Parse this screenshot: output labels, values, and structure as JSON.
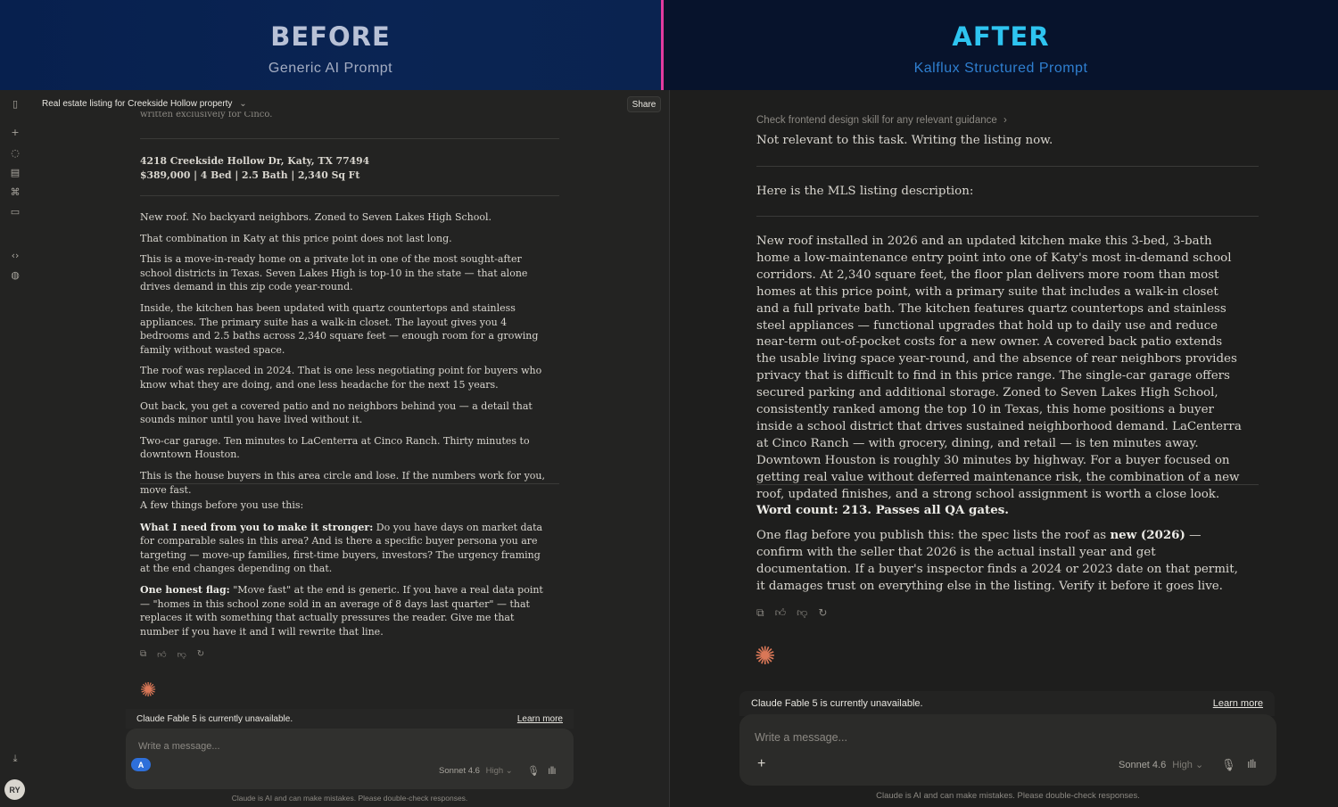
{
  "banners": {
    "before": {
      "title": "BEFORE",
      "subtitle": "Generic AI Prompt"
    },
    "after": {
      "title": "AFTER",
      "subtitle": "Kalflux Structured Prompt"
    }
  },
  "colors": {
    "divider": "#e13ba0",
    "after_title": "#2ec4f0",
    "after_subtitle": "#2f7fd0",
    "claude_star": "#d97757"
  },
  "left": {
    "conversation_title": "Real estate listing for Creekside Hollow property",
    "share_label": "Share",
    "avatar_initials": "RY",
    "rail_icons": [
      "sidebar-toggle-icon",
      "plus-icon",
      "chat-icon",
      "projects-icon",
      "artifacts-icon",
      "briefcase-icon",
      "code-icon",
      "palette-icon",
      "download-icon"
    ],
    "cut_text": "written exclusively for Cinco.",
    "address": "4218 Creekside Hollow Dr, Katy, TX 77494",
    "specs": "$389,000 | 4 Bed | 2.5 Bath | 2,340 Sq Ft",
    "paragraphs": [
      "New roof. No backyard neighbors. Zoned to Seven Lakes High School.",
      "That combination in Katy at this price point does not last long.",
      "This is a move-in-ready home on a private lot in one of the most sought-after school districts in Texas. Seven Lakes High is top-10 in the state — that alone drives demand in this zip code year-round.",
      "Inside, the kitchen has been updated with quartz countertops and stainless appliances. The primary suite has a walk-in closet. The layout gives you 4 bedrooms and 2.5 baths across 2,340 square feet — enough room for a growing family without wasted space.",
      "The roof was replaced in 2024. That is one less negotiating point for buyers who know what they are doing, and one less headache for the next 15 years.",
      "Out back, you get a covered patio and no neighbors behind you — a detail that sounds minor until you have lived without it.",
      "Two-car garage. Ten minutes to LaCenterra at Cinco Ranch. Thirty minutes to downtown Houston.",
      "This is the house buyers in this area circle and lose. If the numbers work for you, move fast."
    ],
    "notes_intro": "A few things before you use this:",
    "note1_label": "What I need from you to make it stronger:",
    "note1_text": " Do you have days on market data for comparable sales in this area? And is there a specific buyer persona you are targeting — move-up families, first-time buyers, investors? The urgency framing at the end changes depending on that.",
    "note2_label": "One honest flag:",
    "note2_text": " \"Move fast\" at the end is generic. If you have a real data point — \"homes in this school zone sold in an average of 8 days last quarter\" — that replaces it with something that actually pressures the reader. Give me that number if you have it and I will rewrite that line.",
    "action_icons": [
      "copy-icon",
      "thumbs-up-icon",
      "thumbs-down-icon",
      "retry-icon"
    ],
    "unavailable": "Claude Fable 5 is currently unavailable.",
    "learn_more": "Learn more",
    "placeholder": "Write a message...",
    "attach_badge": "A",
    "model": "Sonnet 4.6",
    "effort": "High",
    "disclaimer": "Claude is AI and can make mistakes. Please double-check responses."
  },
  "right": {
    "skill_check": "Check frontend design skill for any relevant guidance",
    "not_relevant": "Not relevant to this task. Writing the listing now.",
    "intro": "Here is the MLS listing description:",
    "listing": "New roof installed in 2026 and an updated kitchen make this 3-bed, 3-bath home a low-maintenance entry point into one of Katy's most in-demand school corridors. At 2,340 square feet, the floor plan delivers more room than most homes at this price point, with a primary suite that includes a walk-in closet and a full private bath. The kitchen features quartz countertops and stainless steel appliances — functional upgrades that hold up to daily use and reduce near-term out-of-pocket costs for a new owner. A covered back patio extends the usable living space year-round, and the absence of rear neighbors provides privacy that is difficult to find in this price range. The single-car garage offers secured parking and additional storage. Zoned to Seven Lakes High School, consistently ranked among the top 10 in Texas, this home positions a buyer inside a school district that drives sustained neighborhood demand. LaCenterra at Cinco Ranch — with grocery, dining, and retail — is ten minutes away. Downtown Houston is roughly 30 minutes by highway. For a buyer focused on getting real value without deferred maintenance risk, the combination of a new roof, updated finishes, and a strong school assignment is worth a close look.",
    "word_count": "Word count: 213. Passes all QA gates.",
    "flag_pre": "One flag before you publish this: the spec lists the roof as ",
    "flag_bold": "new (2026)",
    "flag_post": " — confirm with the seller that 2026 is the actual install year and get documentation. If a buyer's inspector finds a 2024 or 2023 date on that permit, it damages trust on everything else in the listing. Verify it before it goes live.",
    "unavailable": "Claude Fable 5 is currently unavailable.",
    "learn_more": "Learn more",
    "placeholder": "Write a message...",
    "plus": "+",
    "model": "Sonnet 4.6",
    "effort": "High",
    "disclaimer": "Claude is AI and can make mistakes. Please double-check responses."
  }
}
